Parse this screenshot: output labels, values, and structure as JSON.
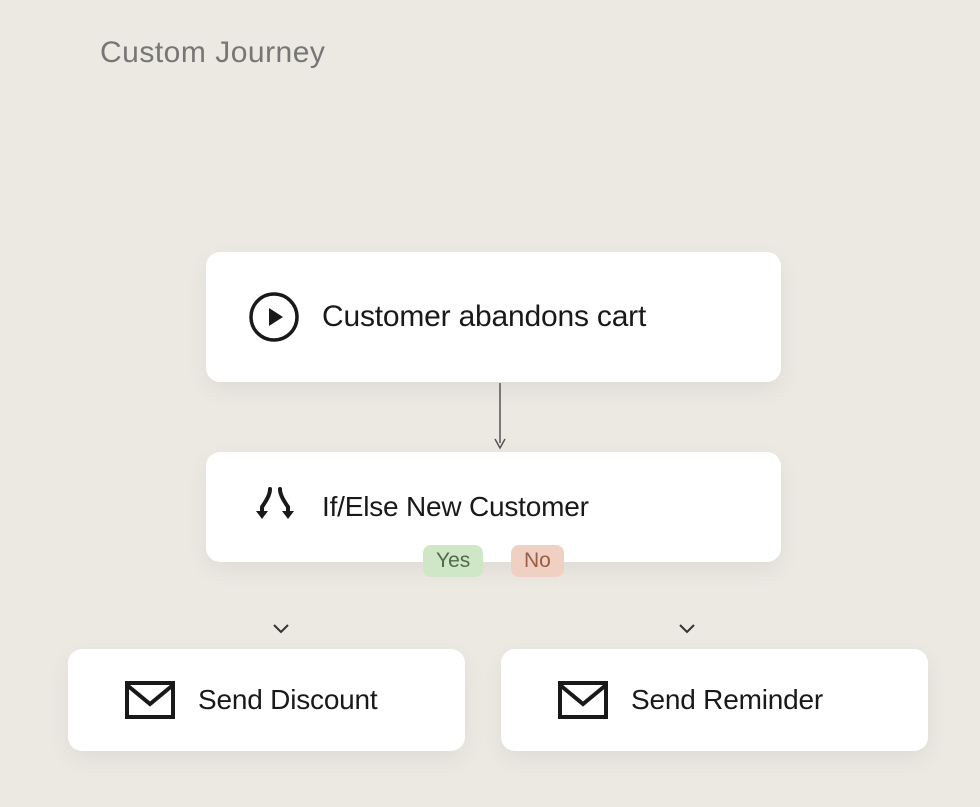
{
  "title": "Custom Journey",
  "nodes": {
    "trigger": {
      "label": "Customer abandons cart"
    },
    "condition": {
      "label": "If/Else  New Customer"
    },
    "branch_left": {
      "label": "Send  Discount"
    },
    "branch_right": {
      "label": "Send  Reminder"
    }
  },
  "badges": {
    "yes": "Yes",
    "no": "No"
  }
}
